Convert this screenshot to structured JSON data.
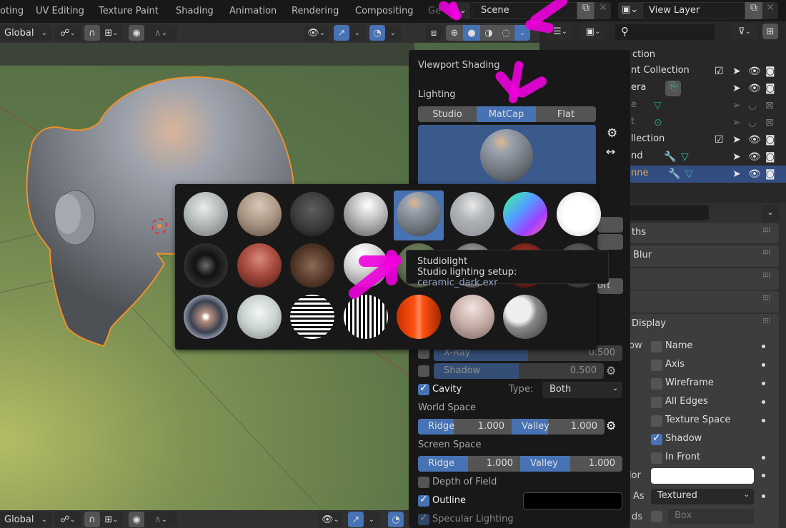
{
  "workspace_tabs": [
    "oting",
    "UV Editing",
    "Texture Paint",
    "Shading",
    "Animation",
    "Rendering",
    "Compositing",
    "Ge"
  ],
  "scene": {
    "name": "Scene",
    "icon": "scene-icon"
  },
  "view_layer": {
    "name": "View Layer",
    "icon": "render-layers-icon"
  },
  "header": {
    "transform_orientation": "Global",
    "viewport_shading_modes": [
      "wireframe",
      "solid",
      "material-preview",
      "rendered"
    ],
    "active_shading_mode": "solid"
  },
  "outliner": {
    "search_placeholder": "",
    "rows": [
      {
        "label": "ction",
        "indent": 0
      },
      {
        "label": "nt Collection",
        "checkbox": true
      },
      {
        "label": "era",
        "type": "camera"
      },
      {
        "label": "e",
        "type": "mesh",
        "hidden": true
      },
      {
        "label": "t",
        "type": "light",
        "hidden": true
      },
      {
        "label": "llection",
        "checkbox": true
      },
      {
        "label": "nd",
        "type": "mesh",
        "modifier": true
      },
      {
        "label": "nne",
        "type": "mesh",
        "modifier": true,
        "selected": true
      }
    ]
  },
  "viewport_shading": {
    "title": "Viewport Shading",
    "lighting_label": "Lighting",
    "lighting_options": [
      "Studio",
      "MatCap",
      "Flat"
    ],
    "lighting_selected": "MatCap",
    "xray": {
      "label": "X-Ray",
      "value": "0.500",
      "fraction": 0.5,
      "enabled": false
    },
    "shadow": {
      "label": "Shadow",
      "value": "0.500",
      "fraction": 0.5,
      "enabled": false
    },
    "cavity": {
      "label": "Cavity",
      "enabled": true,
      "type_label": "Type:",
      "type_value": "Both"
    },
    "world_space": {
      "label": "World Space",
      "ridge_label": "Ridge",
      "ridge": "1.000",
      "valley_label": "Valley",
      "valley": "1.000"
    },
    "screen_space": {
      "label": "Screen Space",
      "ridge_label": "Ridge",
      "ridge": "1.000",
      "valley_label": "Valley",
      "valley": "1.000"
    },
    "depth_of_field": {
      "label": "Depth of Field",
      "enabled": false
    },
    "outline": {
      "label": "Outline",
      "enabled": true,
      "color": "#000000"
    },
    "specular": {
      "label": "Specular Lighting",
      "enabled": true
    },
    "partial_button": "ort"
  },
  "matcaps": {
    "selected_index": 4,
    "count": 23
  },
  "tooltip": {
    "title": "Studiolight",
    "label": "Studio lighting setup:",
    "value": "ceramic_dark.exr"
  },
  "properties": {
    "panels": [
      "ths",
      "Blur",
      "",
      "",
      "Display"
    ],
    "show_label": "ow",
    "options": [
      {
        "label": "Name",
        "checked": false
      },
      {
        "label": "Axis",
        "checked": false
      },
      {
        "label": "Wireframe",
        "checked": false
      },
      {
        "label": "All Edges",
        "checked": false
      },
      {
        "label": "Texture Space",
        "checked": false
      },
      {
        "label": "Shadow",
        "checked": true
      },
      {
        "label": "In Front",
        "checked": false
      }
    ],
    "color_label": "lor",
    "color_value": "#ffffff",
    "display_as_label": "As",
    "display_as": "Textured",
    "bounds_label": "ds",
    "bounds_value": "Box"
  },
  "colors": {
    "accent": "#4772b3",
    "selection_outline": "#f0902a",
    "annotation": "#ee00dd"
  }
}
